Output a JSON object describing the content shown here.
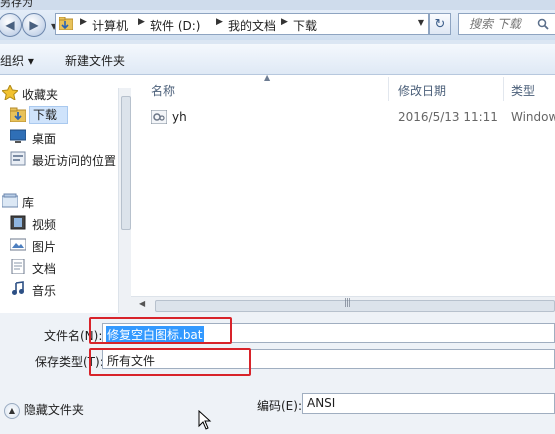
{
  "window": {
    "title": "另存为"
  },
  "address_bar": {
    "crumbs": [
      "计算机",
      "软件 (D:)",
      "我的文档",
      "下载"
    ]
  },
  "search": {
    "placeholder": "搜索 下载"
  },
  "toolbar": {
    "organize_label": "组织 ▾",
    "new_folder_label": "新建文件夹"
  },
  "sidebar": {
    "items": [
      {
        "label": "收藏夹",
        "icon": "star-icon"
      },
      {
        "label": "下载",
        "icon": "download-folder-icon",
        "selected": true
      },
      {
        "label": "桌面",
        "icon": "desktop-icon"
      },
      {
        "label": "最近访问的位置",
        "icon": "recent-places-icon"
      },
      {
        "label": "库",
        "icon": "library-icon"
      },
      {
        "label": "视频",
        "icon": "video-icon"
      },
      {
        "label": "图片",
        "icon": "picture-icon"
      },
      {
        "label": "文档",
        "icon": "document-icon"
      },
      {
        "label": "音乐",
        "icon": "music-icon"
      }
    ]
  },
  "columns": {
    "name": "名称",
    "modified": "修改日期",
    "type": "类型"
  },
  "files": [
    {
      "name": "yh",
      "modified": "2016/5/13 11:11",
      "type": "Window"
    }
  ],
  "form": {
    "filename_label": "文件名(N):",
    "filename_value": "修复空白图标.bat",
    "filetype_label": "保存类型(T):",
    "filetype_value": "所有文件",
    "hide_folders_label": "隐藏文件夹",
    "encoding_label": "编码(E):",
    "encoding_value": "ANSI"
  },
  "colors": {
    "highlight_box": "#d8232a",
    "selection": "#3399ff"
  }
}
